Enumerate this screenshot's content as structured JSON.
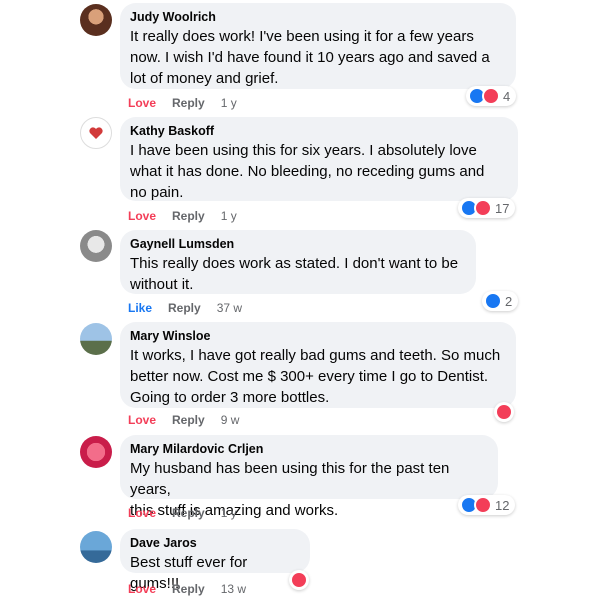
{
  "comments": [
    {
      "author": "Judy Woolrich",
      "text": "It really does work! I've been using it for a few years\nnow. I wish I'd have found it 10 years ago and saved a\nlot of money and grief.",
      "reaction_label": "Love",
      "reply_label": "Reply",
      "age": "1 y",
      "reaction_count": "4",
      "reactions": [
        "like-icon",
        "love-icon"
      ]
    },
    {
      "author": "Kathy Baskoff",
      "text": "I have been using this for six years. I absolutely love\nwhat it has done. No bleeding, no receding gums and\nno pain.",
      "reaction_label": "Love",
      "reply_label": "Reply",
      "age": "1 y",
      "reaction_count": "17",
      "reactions": [
        "like-icon",
        "love-icon"
      ]
    },
    {
      "author": "Gaynell Lumsden",
      "text": "This really does work as stated. I don't want to be\nwithout it.",
      "reaction_label": "Like",
      "reply_label": "Reply",
      "age": "37 w",
      "reaction_count": "2",
      "reactions": [
        "like-icon"
      ]
    },
    {
      "author": "Mary Winsloe",
      "text": "It works, I have got really bad gums and teeth. So much\nbetter now. Cost me $ 300+ every time I go to Dentist.\nGoing to order 3 more bottles.",
      "reaction_label": "Love",
      "reply_label": "Reply",
      "age": "9 w",
      "reaction_count": "",
      "reactions": [
        "love-icon"
      ]
    },
    {
      "author": "Mary Milardovic Crljen",
      "text": "My husband has been using this for the past ten years,\nthis stuff is amazing and works.",
      "reaction_label": "Love",
      "reply_label": "Reply",
      "age": "1 y",
      "reaction_count": "12",
      "reactions": [
        "like-icon",
        "love-icon"
      ]
    },
    {
      "author": "Dave Jaros",
      "text": "Best stuff ever for gums!!!",
      "reaction_label": "Love",
      "reply_label": "Reply",
      "age": "13 w",
      "reaction_count": "",
      "reactions": [
        "love-icon"
      ]
    }
  ],
  "colors": {
    "bubble_bg": "#f0f2f5",
    "love": "#f33e58",
    "like": "#1877f2",
    "meta": "#65676b"
  }
}
